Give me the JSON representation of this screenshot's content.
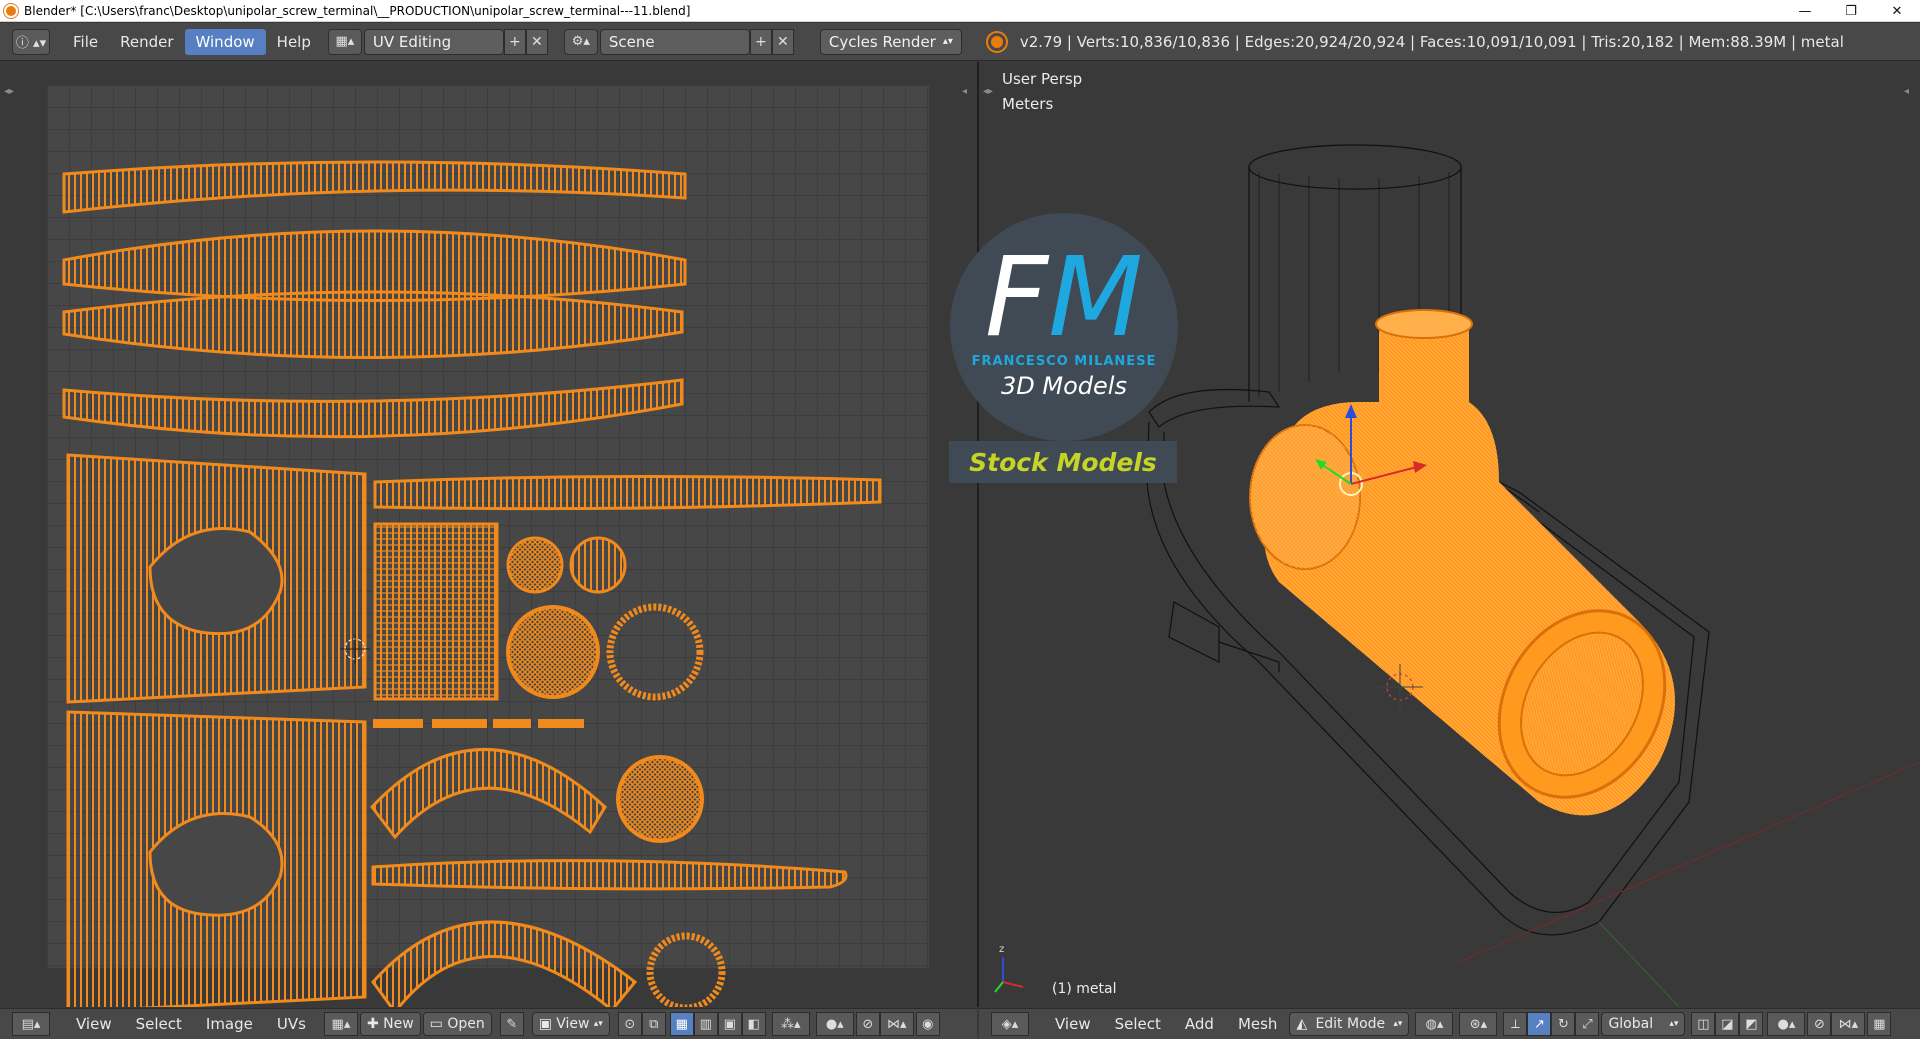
{
  "window": {
    "title": "Blender* [C:\\Users\\franc\\Desktop\\unipolar_screw_terminal\\__PRODUCTION\\unipolar_screw_terminal---11.blend]",
    "minimize": "—",
    "maximize": "❐",
    "close": "✕"
  },
  "info_header": {
    "menus": [
      "File",
      "Render",
      "Window",
      "Help"
    ],
    "active_menu": "Window",
    "screen_layout": "UV Editing",
    "scene": "Scene",
    "render_engine": "Cycles Render",
    "stats": "v2.79 | Verts:10,836/10,836 | Edges:20,924/20,924 | Faces:10,091/10,091 | Tris:20,182 | Mem:88.39M | metal"
  },
  "uv_editor": {
    "footer_menus": [
      "View",
      "Select",
      "Image",
      "UVs"
    ],
    "new_label": "New",
    "open_label": "Open",
    "view_label": "View"
  },
  "viewport": {
    "view_name": "User Persp",
    "units": "Meters",
    "object_label": "(1) metal",
    "footer_menus": [
      "View",
      "Select",
      "Add",
      "Mesh"
    ],
    "mode": "Edit Mode",
    "orientation": "Global"
  },
  "watermark": {
    "initials_f": "F",
    "initials_m": "M",
    "name": "FRANCESCO MILANESE",
    "subtitle": "3D Models",
    "banner": "Stock Models"
  },
  "colors": {
    "uv_orange": "#f08a1c",
    "mesh_orange": "#ff9a1f",
    "active_blue": "#5680c2",
    "logo_blue": "#1fa8df",
    "banner_green": "#c6d425"
  }
}
